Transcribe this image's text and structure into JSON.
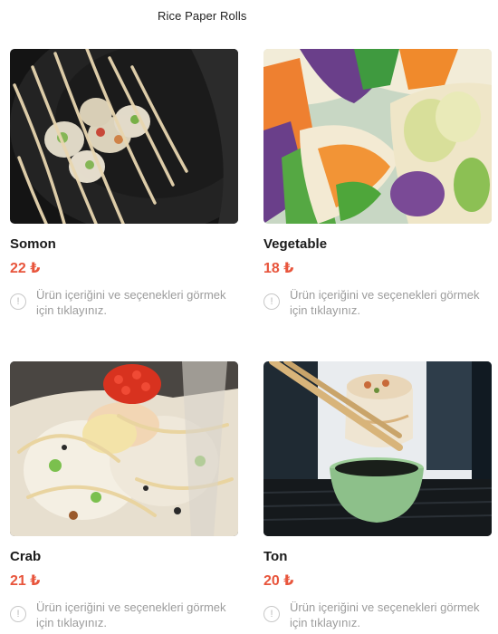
{
  "section": {
    "title": "Rice Paper Rolls"
  },
  "products": [
    {
      "name": "Somon",
      "price": "22 ₺",
      "info_text": "Ürün içeriğini ve seçenekleri görmek için tıklayınız.",
      "info_icon": "exclamation-circle-icon"
    },
    {
      "name": "Vegetable",
      "price": "18 ₺",
      "info_text": "Ürün içeriğini ve seçenekleri görmek için tıklayınız.",
      "info_icon": "exclamation-circle-icon"
    },
    {
      "name": "Crab",
      "price": "21 ₺",
      "info_text": "Ürün içeriğini ve seçenekleri görmek için tıklayınız.",
      "info_icon": "exclamation-circle-icon"
    },
    {
      "name": "Ton",
      "price": "20 ₺",
      "info_text": "Ürün içeriğini ve seçenekleri görmek için tıklayınız.",
      "info_icon": "exclamation-circle-icon"
    }
  ],
  "colors": {
    "price": "#e8553c",
    "name": "#1a1a1a",
    "info_text": "#9c9c9c"
  }
}
